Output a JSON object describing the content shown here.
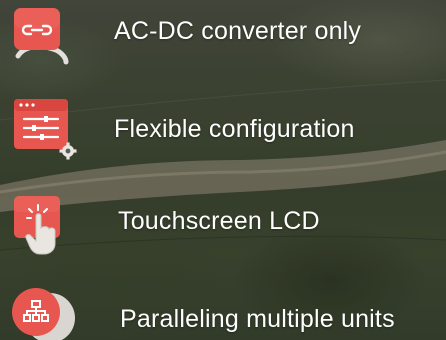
{
  "colors": {
    "accent": "#e8574f",
    "accent_dark": "#d9463f",
    "text": "#ffffff"
  },
  "features": [
    {
      "icon": "link-icon",
      "label": "AC-DC converter only"
    },
    {
      "icon": "settings-sliders-icon",
      "label": "Flexible configuration"
    },
    {
      "icon": "touch-tap-icon",
      "label": "Touchscreen LCD"
    },
    {
      "icon": "sitemap-hierarchy-icon",
      "label": "Paralleling multiple units"
    }
  ]
}
